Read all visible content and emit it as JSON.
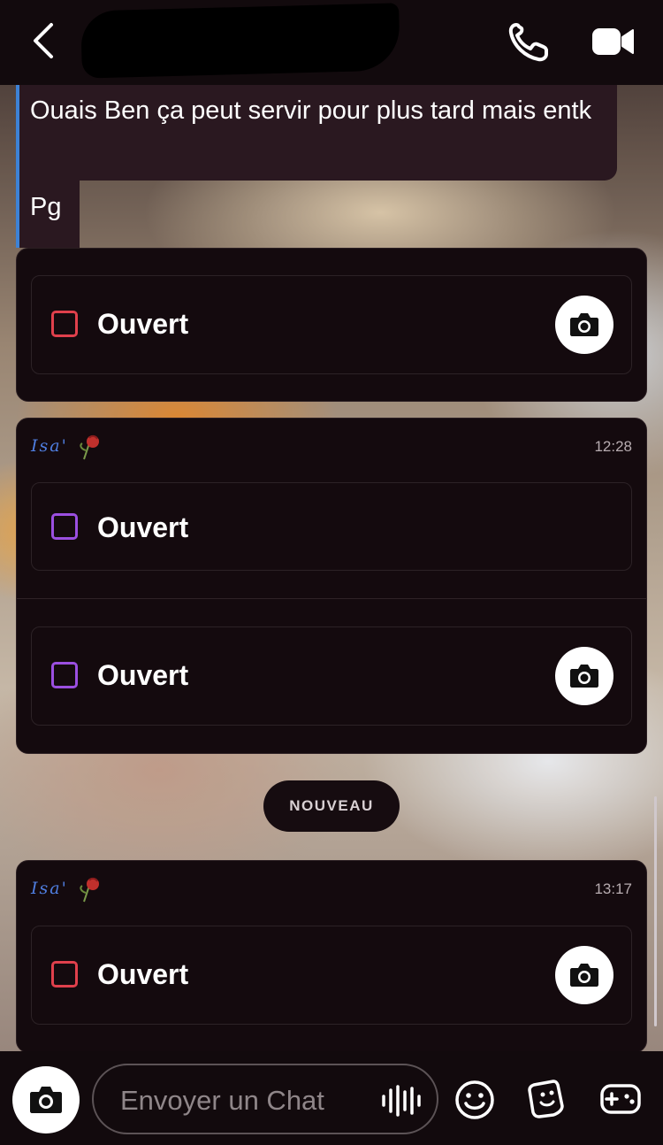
{
  "header": {
    "back_icon": "chevron-left-icon",
    "call_icon": "phone-icon",
    "video_icon": "video-camera-icon",
    "contact_name_redacted": true
  },
  "messages": {
    "text_1": "Ouais Ben ça peut servir pour plus tard mais entk",
    "text_2": "Pg",
    "accent_color": "#3d82d6"
  },
  "snap_groups": [
    {
      "sender": "",
      "time": "",
      "snaps": [
        {
          "label": "Ouvert",
          "color": "#e0404c",
          "has_reply_camera": true
        }
      ]
    },
    {
      "sender": "Isa'",
      "time": "12:28",
      "snaps": [
        {
          "label": "Ouvert",
          "color": "#9b4fe0",
          "has_reply_camera": false
        },
        {
          "label": "Ouvert",
          "color": "#9b4fe0",
          "has_reply_camera": true
        }
      ]
    },
    {
      "sender": "Isa'",
      "time": "13:17",
      "snaps": [
        {
          "label": "Ouvert",
          "color": "#e0404c",
          "has_reply_camera": true
        }
      ]
    }
  ],
  "divider_label": "NOUVEAU",
  "composer": {
    "placeholder": "Envoyer un Chat",
    "camera_icon": "camera-icon",
    "voice_icon": "voice-waveform-icon",
    "emoji_icon": "emoji-icon",
    "sticker_icon": "sticker-icon",
    "game_icon": "game-controller-icon"
  }
}
